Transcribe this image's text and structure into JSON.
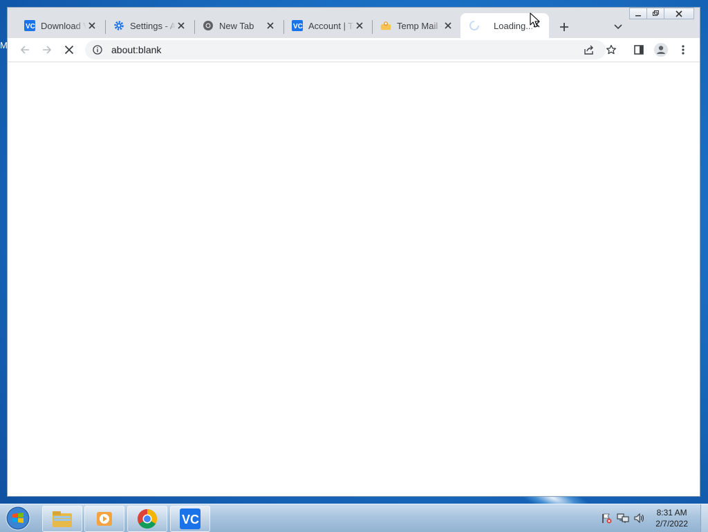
{
  "desktop": {
    "edge_letter": "M"
  },
  "browser": {
    "tabs": [
      {
        "title": "Download V",
        "icon": "vc-logo-icon",
        "active": false
      },
      {
        "title": "Settings - A",
        "icon": "gear-icon",
        "active": false
      },
      {
        "title": "New Tab",
        "icon": "chrome-icon",
        "active": false
      },
      {
        "title": "Account | Te",
        "icon": "vc-logo-icon",
        "active": false
      },
      {
        "title": "Temp Mail -",
        "icon": "temp-mail-icon",
        "active": false
      },
      {
        "title": "Loading...",
        "icon": "loading-spinner-icon",
        "active": true
      }
    ],
    "address": {
      "url": "about:blank"
    },
    "accent_color": "#1a73e8"
  },
  "taskbar": {
    "apps": [
      {
        "name": "Windows Explorer",
        "icon": "folder-icon"
      },
      {
        "name": "Media Player",
        "icon": "media-player-icon"
      },
      {
        "name": "Google Chrome",
        "icon": "chrome-icon"
      },
      {
        "name": "VeraCrypt",
        "icon": "vc-logo-icon"
      }
    ],
    "clock": {
      "time": "8:31 AM",
      "date": "2/7/2022"
    }
  }
}
